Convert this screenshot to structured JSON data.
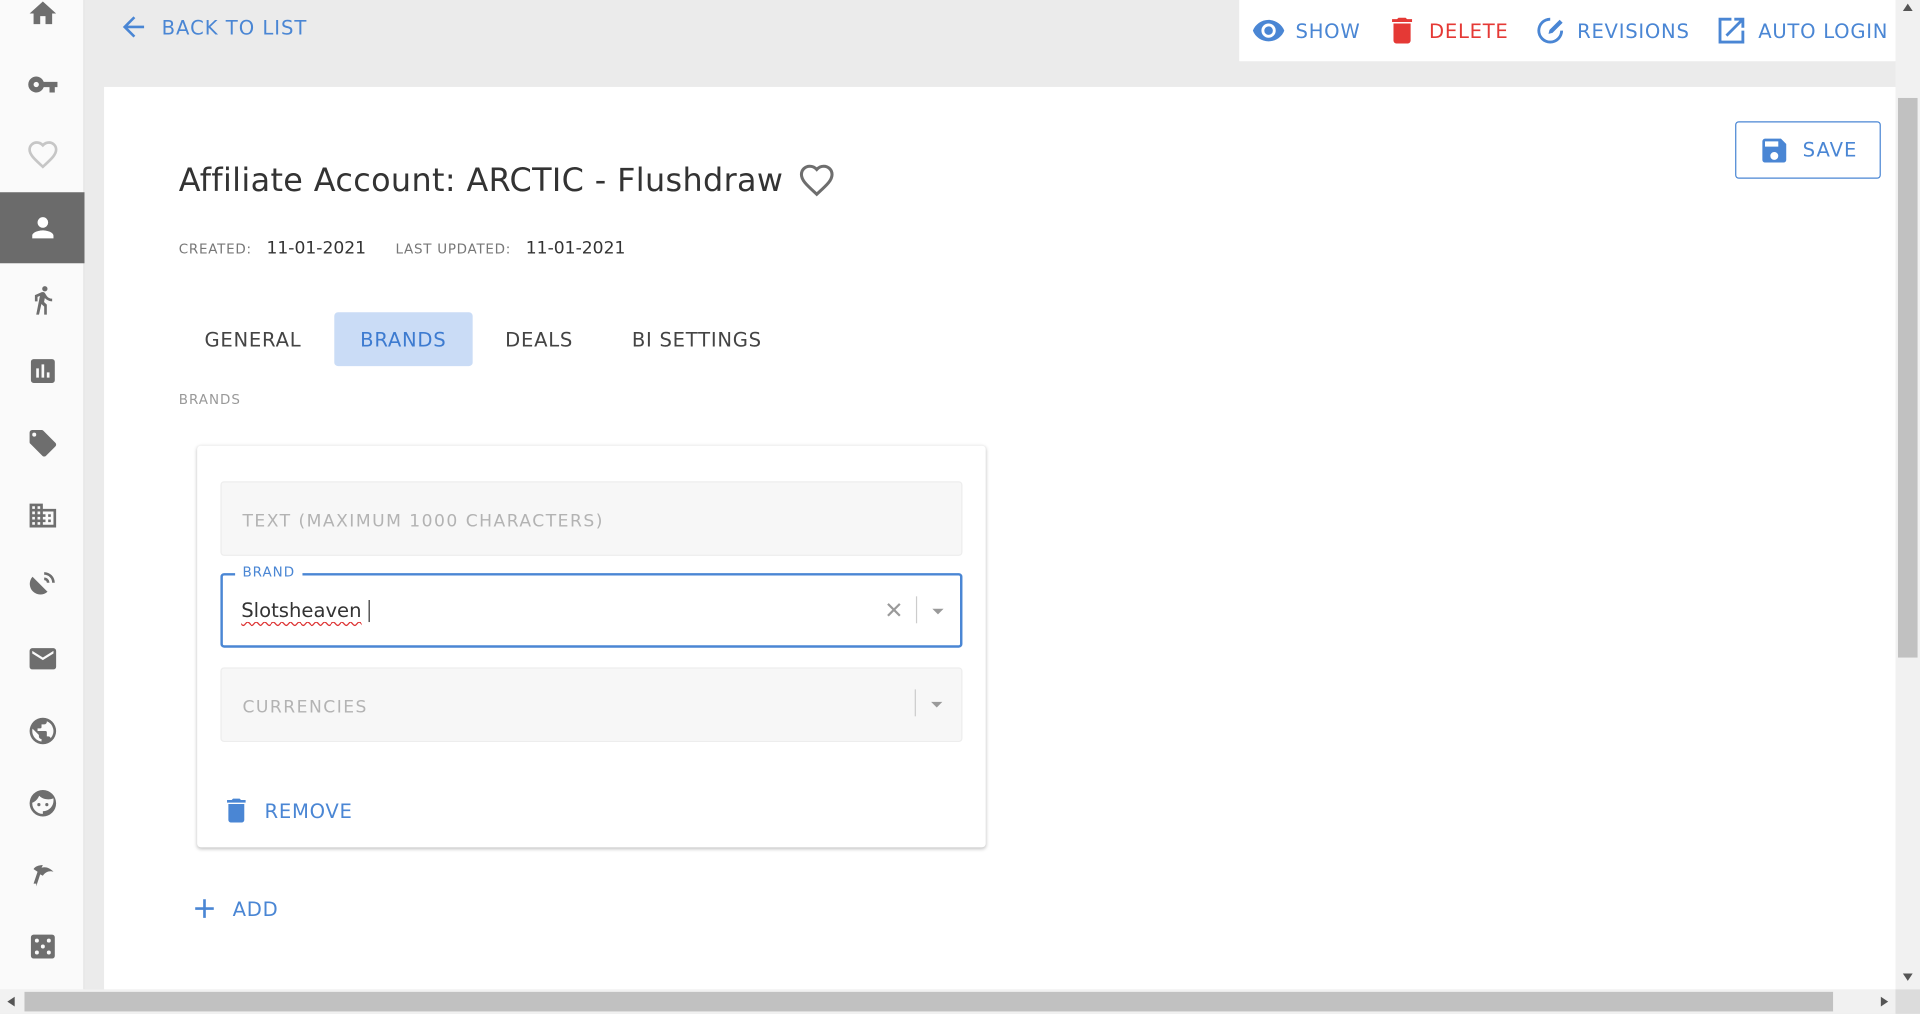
{
  "topbar": {
    "back_label": "BACK TO LIST",
    "actions": [
      {
        "label": "SHOW",
        "icon": "eye-icon",
        "color": "#4a86d4"
      },
      {
        "label": "DELETE",
        "icon": "trash-icon",
        "color": "#e53935"
      },
      {
        "label": "REVISIONS",
        "icon": "revisions-icon",
        "color": "#4a86d4"
      },
      {
        "label": "AUTO LOGIN",
        "icon": "open-in-new-icon",
        "color": "#4a86d4"
      }
    ]
  },
  "sidebar": {
    "items": [
      {
        "icon": "home-icon",
        "active": false
      },
      {
        "icon": "key-icon",
        "active": false
      },
      {
        "icon": "heart-outline-icon",
        "active": false
      },
      {
        "icon": "person-icon",
        "active": true
      },
      {
        "icon": "runner-icon",
        "active": false
      },
      {
        "icon": "bar-chart-icon",
        "active": false
      },
      {
        "icon": "tag-icon",
        "active": false
      },
      {
        "icon": "building-icon",
        "active": false
      },
      {
        "icon": "satellite-dish-icon",
        "active": false
      },
      {
        "icon": "mail-icon",
        "active": false
      },
      {
        "icon": "globe-icon",
        "active": false
      },
      {
        "icon": "face-icon",
        "active": false
      },
      {
        "icon": "flag-icon",
        "active": false
      },
      {
        "icon": "dice-icon",
        "active": false
      }
    ]
  },
  "page": {
    "save_label": "SAVE",
    "title": "Affiliate Account: ARCTIC - Flushdraw",
    "created_label": "CREATED:",
    "created_value": "11-01-2021",
    "updated_label": "LAST UPDATED:",
    "updated_value": "11-01-2021",
    "tabs": [
      {
        "label": "GENERAL",
        "active": false
      },
      {
        "label": "BRANDS",
        "active": true
      },
      {
        "label": "DEALS",
        "active": false
      },
      {
        "label": "BI SETTINGS",
        "active": false
      }
    ],
    "section_label": "BRANDS",
    "brand_entry": {
      "text_placeholder": "TEXT (MAXIMUM 1000 CHARACTERS)",
      "brand_label": "BRAND",
      "brand_value": "Slotsheaven",
      "currencies_placeholder": "CURRENCIES",
      "remove_label": "REMOVE"
    },
    "add_label": "ADD"
  },
  "colors": {
    "accent": "#4a86d4",
    "danger": "#e53935",
    "active_tab_bg": "#cadcf6",
    "sidebar_active_bg": "#6b6b6b"
  }
}
